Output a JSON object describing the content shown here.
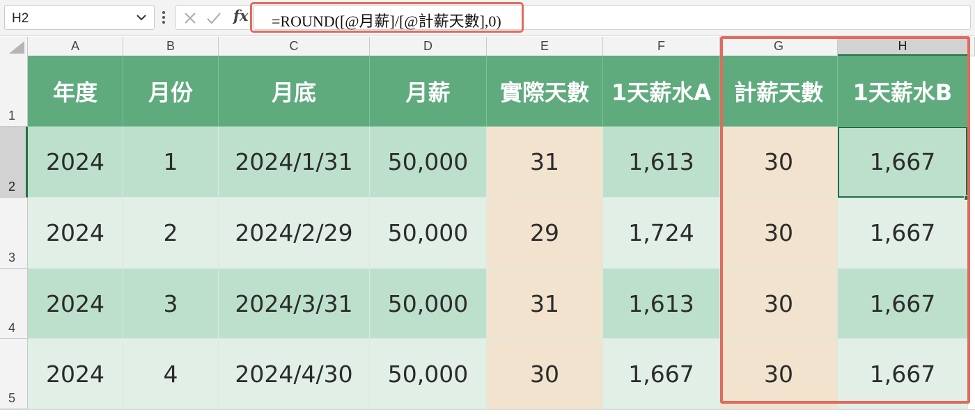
{
  "formula_bar": {
    "name_box": "H2",
    "fx_label": "fx",
    "formula": "=ROUND([@月薪]/[@計薪天數],0)"
  },
  "sheet": {
    "selected_cell": "H2",
    "columns": [
      "A",
      "B",
      "C",
      "D",
      "E",
      "F",
      "G",
      "H"
    ],
    "row_numbers": [
      "1",
      "2",
      "3",
      "4",
      "5"
    ],
    "table": {
      "headers": [
        "年度",
        "月份",
        "月底",
        "月薪",
        "實際天數",
        "1天薪水A",
        "計薪天數",
        "1天薪水B"
      ],
      "rows": [
        [
          "2024",
          "1",
          "2024/1/31",
          "50,000",
          "31",
          "1,613",
          "30",
          "1,667"
        ],
        [
          "2024",
          "2",
          "2024/2/29",
          "50,000",
          "29",
          "1,724",
          "30",
          "1,667"
        ],
        [
          "2024",
          "3",
          "2024/3/31",
          "50,000",
          "31",
          "1,613",
          "30",
          "1,667"
        ],
        [
          "2024",
          "4",
          "2024/4/30",
          "50,000",
          "30",
          "1,667",
          "30",
          "1,667"
        ]
      ]
    }
  },
  "colors": {
    "header_fill": "#5fab7d",
    "band_dark": "#bde0cd",
    "band_light": "#e1efe7",
    "day_column_fill": "#f1e3cd",
    "highlight_outline": "#e06b5c",
    "selection": "#1e6e44"
  },
  "icons": {
    "name_box_dropdown": "chevron-down-icon",
    "more": "vertical-dots-icon",
    "cancel": "cancel-x-icon",
    "enter": "enter-check-icon",
    "function": "fx-icon",
    "select_all": "select-all-triangle-icon"
  }
}
